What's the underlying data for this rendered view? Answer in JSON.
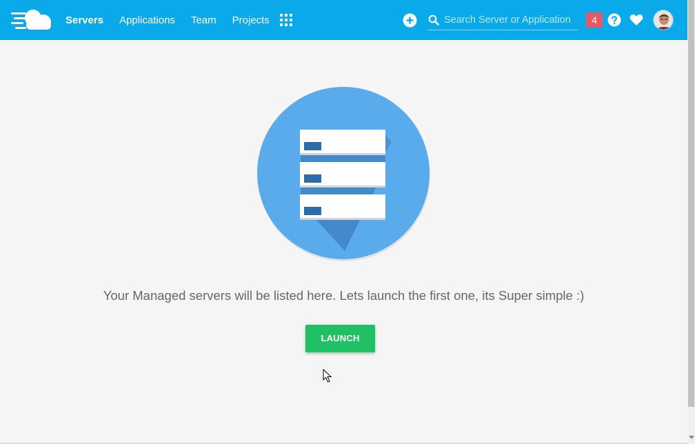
{
  "header": {
    "logo": "cloudways-logo",
    "nav": [
      {
        "label": "Servers",
        "active": true
      },
      {
        "label": "Applications",
        "active": false
      },
      {
        "label": "Team",
        "active": false
      },
      {
        "label": "Projects",
        "active": false
      }
    ],
    "apps_icon": "grid-icon",
    "add_icon": "plus-circle-icon",
    "search": {
      "placeholder": "Search Server or Application",
      "value": ""
    },
    "notification_count": "4",
    "help_icon": "question-circle-icon",
    "heart_icon": "heart-icon",
    "avatar": "user-avatar"
  },
  "empty_state": {
    "illustration": "server-stack-illustration",
    "message": "Your Managed servers will be listed here. Lets launch the first one, its Super simple :)",
    "launch_label": "LAUNCH"
  },
  "colors": {
    "header_bg": "#0aa9e9",
    "circle": "#5aabec",
    "badge": "#e45a66",
    "launch": "#22c065"
  }
}
